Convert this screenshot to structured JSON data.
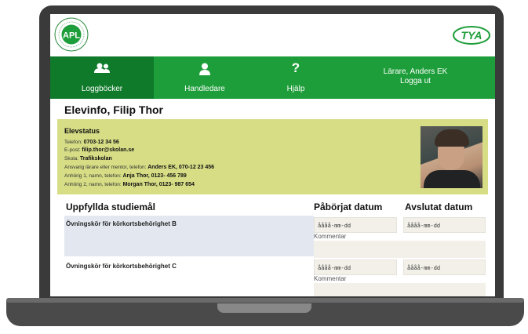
{
  "logos": {
    "left_text": "APL",
    "right_text": "TYA"
  },
  "nav": {
    "items": [
      {
        "label": "Loggböcker",
        "icon": "people-icon"
      },
      {
        "label": "Handledare",
        "icon": "person-icon"
      },
      {
        "label": "Hjälp",
        "icon": "question-icon"
      }
    ],
    "user_name": "Lärare, Anders EK",
    "logout": "Logga ut"
  },
  "page": {
    "title": "Elevinfo, Filip Thor"
  },
  "status": {
    "heading": "Elevstatus",
    "lines": [
      {
        "label": "Telefon:",
        "value": "0703-12 34 56"
      },
      {
        "label": "E-post:",
        "value": "filip.thor@skolan.se"
      },
      {
        "label": "Skola:",
        "value": "Trafikskolan"
      },
      {
        "label": "Ansvarig lärare eller mentor, telefon:",
        "value": "Anders EK, 070-12 23 456"
      },
      {
        "label": "Anhörig 1, namn, telefon:",
        "value": "Anja Thor, 0123- 456 789"
      },
      {
        "label": "Anhörig 2, namn, telefon:",
        "value": "Morgan Thor, 0123- 987 654"
      }
    ]
  },
  "goals": {
    "headers": [
      "Uppfyllda studiemål",
      "Påbörjat datum",
      "Avslutat datum"
    ],
    "rows": [
      {
        "name": "Övningskör för körkortsbehörighet B",
        "start": "åååå-mm-dd",
        "end": "åååå-mm-dd",
        "comment_label": "Kommentar"
      },
      {
        "name": "Övningskör för körkortsbehörighet C",
        "start": "åååå-mm-dd",
        "end": "åååå-mm-dd",
        "comment_label": "Kommentar"
      }
    ]
  },
  "colors": {
    "nav_green": "#1e9e3a",
    "nav_active": "#0f7a2a",
    "status_bg": "#d6dd85"
  }
}
